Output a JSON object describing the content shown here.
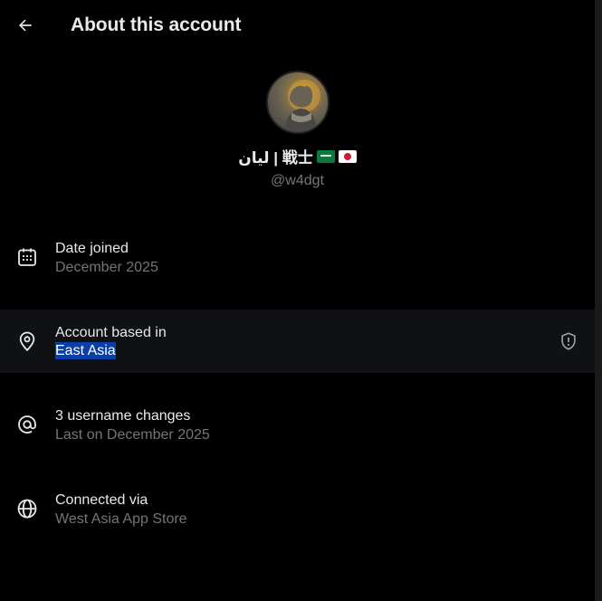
{
  "header": {
    "title": "About this account",
    "back_icon": "arrow-left-icon"
  },
  "profile": {
    "display_name": "ليان | 戦士",
    "flags": [
      "saudi-arabia-flag",
      "japan-flag"
    ],
    "handle": "@w4dgt"
  },
  "rows": [
    {
      "icon": "calendar-icon",
      "label": "Date joined",
      "value": "December 2025"
    },
    {
      "icon": "location-pin-icon",
      "label": "Account based in",
      "value": "East Asia",
      "action_icon": "shield-alert-icon"
    },
    {
      "icon": "at-sign-icon",
      "label": "3 username changes",
      "value": "Last on December 2025"
    },
    {
      "icon": "globe-icon",
      "label": "Connected via",
      "value": "West Asia App Store"
    }
  ],
  "colors": {
    "background": "#000000",
    "primary_text": "#e7e9ea",
    "secondary_text": "#71767b",
    "highlight_row": "#0f1114",
    "selection": "#0a3fa8"
  }
}
